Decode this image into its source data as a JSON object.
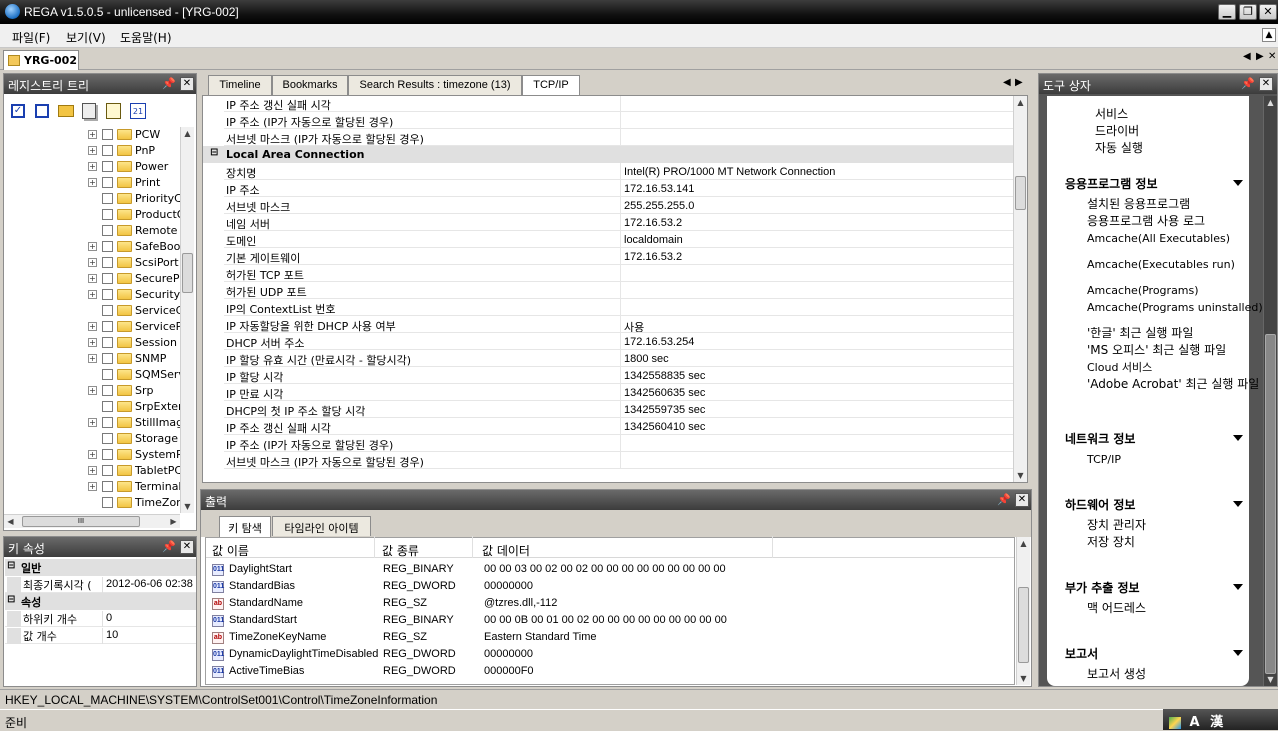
{
  "window": {
    "title": "REGA v1.5.0.5 - unlicensed - [YRG-002]",
    "min": "▁",
    "max": "❐",
    "close": "✕"
  },
  "menu": {
    "file": "파일(F)",
    "view": "보기(V)",
    "help": "도움말(H)"
  },
  "doc_tab": {
    "label": "YRG-002"
  },
  "registry_tree": {
    "title": "레지스트리 트리",
    "items": [
      "PCW",
      "PnP",
      "Power",
      "Print",
      "PriorityC",
      "ProductO",
      "Remote",
      "SafeBoo",
      "ScsiPort",
      "SecurePi",
      "SecurityI",
      "ServiceG",
      "ServiceP",
      "Session I",
      "SNMP",
      "SQMServ",
      "Srp",
      "SrpExter",
      "StillImag",
      "Storage",
      "SystemR",
      "TabletPC",
      "Terminal",
      "TimeZon"
    ],
    "expandable": [
      true,
      true,
      true,
      true,
      false,
      false,
      false,
      true,
      true,
      true,
      true,
      false,
      true,
      true,
      true,
      false,
      true,
      false,
      true,
      false,
      true,
      true,
      true,
      false
    ]
  },
  "key_props": {
    "title": "키 속성",
    "groups": [
      {
        "name": "일반",
        "rows": [
          {
            "label": "최종기록시각 (",
            "value": "2012-06-06  02:38"
          }
        ]
      },
      {
        "name": "속성",
        "rows": [
          {
            "label": "하위키 개수",
            "value": "0"
          },
          {
            "label": "값 개수",
            "value": "10"
          }
        ]
      }
    ]
  },
  "main_tabs": [
    "Timeline",
    "Bookmarks",
    "Search Results : timezone (13)",
    "TCP/IP"
  ],
  "tcpip": {
    "top_rows": [
      {
        "name": "IP 주소 갱신 실패 시각",
        "value": ""
      },
      {
        "name": "IP 주소 (IP가 자동으로 할당된 경우)",
        "value": ""
      },
      {
        "name": "서브넷 마스크 (IP가 자동으로 할당된 경우)",
        "value": ""
      }
    ],
    "group": "Local Area Connection",
    "rows": [
      {
        "name": "장치명",
        "value": "Intel(R) PRO/1000 MT Network Connection"
      },
      {
        "name": "IP 주소",
        "value": "172.16.53.141"
      },
      {
        "name": "서브넷 마스크",
        "value": "255.255.255.0"
      },
      {
        "name": "네임 서버",
        "value": "172.16.53.2"
      },
      {
        "name": "도메인",
        "value": "localdomain"
      },
      {
        "name": "기본 게이트웨이",
        "value": "172.16.53.2"
      },
      {
        "name": "허가된 TCP 포트",
        "value": ""
      },
      {
        "name": "허가된 UDP 포트",
        "value": ""
      },
      {
        "name": "IP의 ContextList 번호",
        "value": ""
      },
      {
        "name": "IP 자동할당을 위한 DHCP 사용 여부",
        "value": "사용"
      },
      {
        "name": "DHCP 서버 주소",
        "value": "172.16.53.254"
      },
      {
        "name": "IP 할당 유효 시간 (만료시각 - 할당시각)",
        "value": "1800 sec"
      },
      {
        "name": "IP 할당 시각",
        "value": "1342558835 sec"
      },
      {
        "name": "IP 만료 시각",
        "value": "1342560635 sec"
      },
      {
        "name": "DHCP의 첫 IP 주소 할당 시각",
        "value": "1342559735 sec"
      },
      {
        "name": "IP 주소 갱신 실패 시각",
        "value": "1342560410 sec"
      },
      {
        "name": "IP 주소 (IP가 자동으로 할당된 경우)",
        "value": ""
      },
      {
        "name": "서브넷 마스크 (IP가 자동으로 할당된 경우)",
        "value": ""
      }
    ]
  },
  "output": {
    "title": "출력",
    "tabs": [
      "키 탐색",
      "타임라인 아이템"
    ],
    "columns": [
      "값 이름",
      "값 종류",
      "값 데이터"
    ],
    "rows": [
      {
        "name": "DaylightStart",
        "type": "REG_BINARY",
        "data": "00 00 03 00 02 00 02 00 00 00 00 00 00 00 00 00",
        "icon": "binary"
      },
      {
        "name": "StandardBias",
        "type": "REG_DWORD",
        "data": "00000000",
        "icon": "binary"
      },
      {
        "name": "StandardName",
        "type": "REG_SZ",
        "data": "@tzres.dll,-112",
        "icon": "string"
      },
      {
        "name": "StandardStart",
        "type": "REG_BINARY",
        "data": "00 00 0B 00 01 00 02 00 00 00 00 00 00 00 00 00",
        "icon": "binary"
      },
      {
        "name": "TimeZoneKeyName",
        "type": "REG_SZ",
        "data": "Eastern Standard Time",
        "icon": "string"
      },
      {
        "name": "DynamicDaylightTimeDisabled",
        "type": "REG_DWORD",
        "data": "00000000",
        "icon": "binary"
      },
      {
        "name": "ActiveTimeBias",
        "type": "REG_DWORD",
        "data": "000000F0",
        "icon": "binary"
      }
    ]
  },
  "toolbox": {
    "title": "도구 상자",
    "top_items": [
      "서비스",
      "드라이버",
      "자동 실행"
    ],
    "sections": [
      {
        "title": "응용프로그램 정보",
        "items": [
          "설치된 응용프로그램",
          "응용프로그램 사용 로그",
          "Amcache(All Executables)",
          "Amcache(Executables run)",
          "Amcache(Programs)",
          "Amcache(Programs uninstalled)",
          "'한글' 최근 실행 파일",
          "'MS 오피스' 최근 실행 파일",
          "Cloud 서비스",
          "'Adobe Acrobat' 최근 실행 파일"
        ]
      },
      {
        "title": "네트워크 정보",
        "items": [
          "TCP/IP"
        ]
      },
      {
        "title": "하드웨어 정보",
        "items": [
          "장치 관리자",
          "저장 장치"
        ]
      },
      {
        "title": "부가 추출 정보",
        "items": [
          "맥 어드레스"
        ]
      },
      {
        "title": "보고서",
        "items": [
          "보고서 생성"
        ]
      }
    ]
  },
  "status": {
    "path": "HKEY_LOCAL_MACHINE\\SYSTEM\\ControlSet001\\Control\\TimeZoneInformation",
    "text": "준비",
    "ime_a": "A",
    "ime_han": "漢"
  },
  "icons": {
    "pin": "pin-icon",
    "close": "close-icon"
  }
}
